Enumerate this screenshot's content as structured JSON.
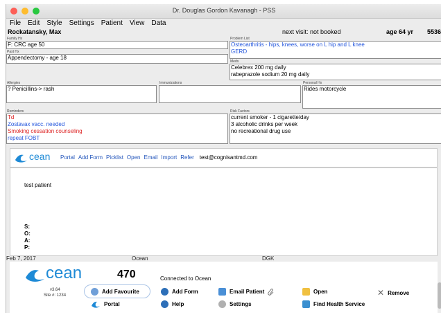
{
  "window": {
    "title": "Dr. Douglas Gordon Kavanagh - PSS"
  },
  "menu": [
    "File",
    "Edit",
    "Style",
    "Settings",
    "Patient",
    "View",
    "Data"
  ],
  "patient": {
    "name": "Rockatansky, Max",
    "next_visit": "next visit:  not booked",
    "age": "age 64 yr",
    "id_partial": "5536"
  },
  "family_hx": {
    "label": "Family Hx",
    "items": [
      "F: CRC age 50"
    ]
  },
  "past_hx": {
    "label": "Past Hx",
    "items": [
      "Appendectomy - age 18"
    ]
  },
  "problem_list": {
    "label": "Problem List",
    "items": [
      "Osteoarthritis - hips, knees, worse on L hip and L knee",
      "GERD"
    ]
  },
  "meds": {
    "label": "Meds",
    "items": [
      "Celebrex 200 mg daily",
      "rabeprazole sodium 20 mg daily"
    ]
  },
  "allergies": {
    "label": "Allergies",
    "items": [
      "? Penicillins-> rash"
    ]
  },
  "immunizations": {
    "label": "Immunizations",
    "items": []
  },
  "personal_hx": {
    "label": "Personal Hx",
    "items": [
      "Rides motorcycle"
    ]
  },
  "reminders": {
    "label": "Reminders",
    "items": [
      "Td",
      "Zostavax vacc. needed",
      "Smoking cessation counseling",
      " repeat FOBT"
    ]
  },
  "risk_factors": {
    "label": "Risk Factors",
    "items": [
      "current smoker - 1 cigarette/day",
      "3 alcoholic drinks per week",
      "no recreational drug use"
    ]
  },
  "ocean_bar": {
    "logo_text": "cean",
    "links": [
      "Portal",
      "Add Form",
      "Picklist",
      "Open",
      "Email",
      "Import",
      "Refer"
    ],
    "email": "test@cognisantmd.com"
  },
  "notes": {
    "text": "test patient",
    "soap": [
      "S:",
      "O:",
      "A:",
      "P:"
    ]
  },
  "encounter_footer": {
    "date": "Feb 7, 2017",
    "source": "Ocean",
    "provider": "DGK"
  },
  "ocean_panel": {
    "logo_text": "cean",
    "version": "v3.64",
    "site": "Site #: 1234",
    "count": "470",
    "status": "Connected to Ocean",
    "buttons": {
      "add_favourite": "Add Favourite",
      "portal": "Portal",
      "add_form": "Add Form",
      "help": "Help",
      "email_patient": "Email Patient",
      "settings": "Settings",
      "open": "Open",
      "find_health_service": "Find Health Service",
      "remove": "Remove"
    }
  },
  "colors": {
    "red_light": "#fd5f57",
    "yellow_light": "#febc2e",
    "green_light": "#28c840",
    "ocean_blue": "#1e8ad6",
    "link_blue": "#2255dd",
    "reminder_red": "#dd2222"
  }
}
